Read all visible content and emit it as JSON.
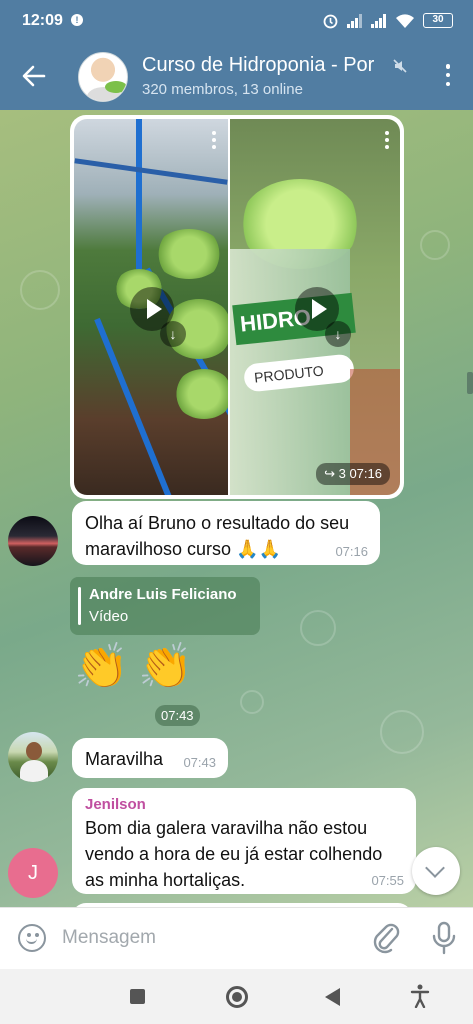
{
  "status_bar": {
    "time": "12:09",
    "notification_badge": "!",
    "battery": "30"
  },
  "header": {
    "title": "Curso de Hidroponia - Por",
    "subtitle": "320 membros, 13 online"
  },
  "messages": {
    "media_album": {
      "left_overlay_text": "HIDRO",
      "right_overlay_text": "PRODUTO",
      "forward_count": "3",
      "time": "07:16"
    },
    "msg1": {
      "text_line1": "Olha aí Bruno o resultado do seu",
      "text_line2": "maravilhoso curso 🙏🙏",
      "time": "07:16"
    },
    "forwarded": {
      "name": "Andre Luis Feliciano",
      "type": "Vídeo"
    },
    "emoji_msg": {
      "emoji1": "👏",
      "emoji2": "👏",
      "time": "07:43"
    },
    "msg2": {
      "text": "Maravilha",
      "time": "07:43"
    },
    "msg3": {
      "sender": "Jenilson",
      "text_line1": "Bom dia galera varavilha não estou",
      "text_line2": "vendo a hora de eu já estar colhendo",
      "text_line3": "as minha hortaliças.",
      "time": "07:55",
      "avatar_initial": "J"
    }
  },
  "input_bar": {
    "placeholder": "Mensagem"
  },
  "colors": {
    "header": "#517da2",
    "sender_name": "#c04fa0",
    "avatar_j": "#e86d8f"
  }
}
